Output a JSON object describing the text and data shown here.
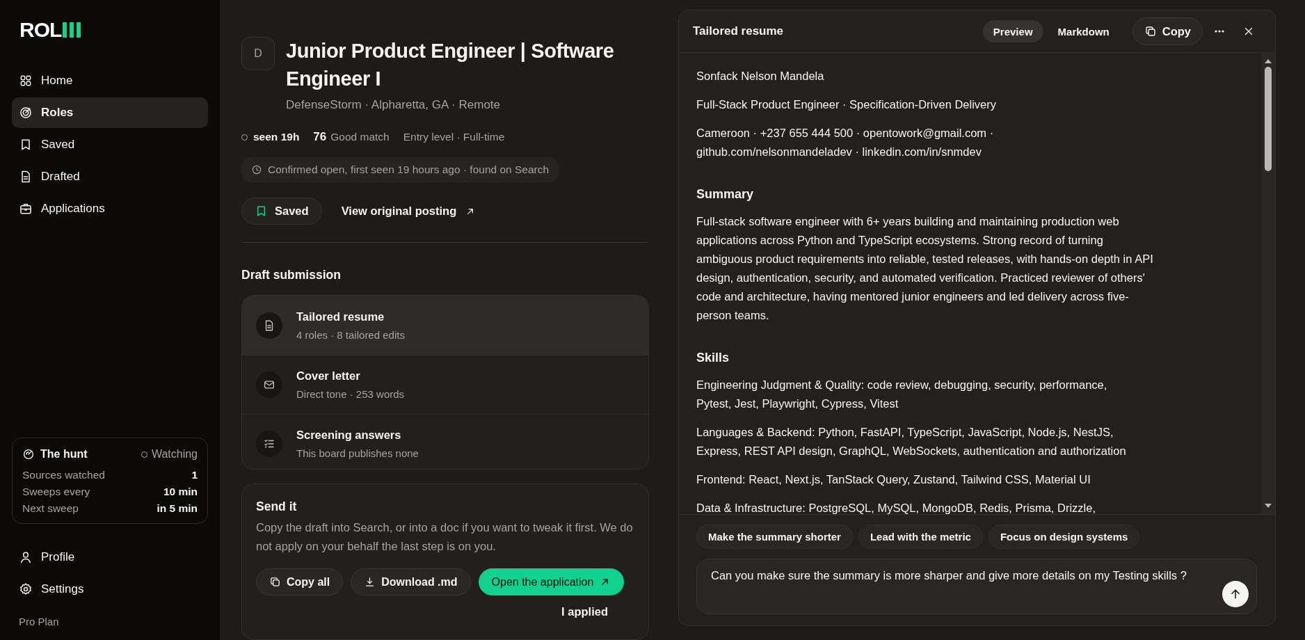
{
  "sidebar": {
    "logo": "ROL",
    "nav": [
      {
        "label": "Home",
        "selected": false
      },
      {
        "label": "Roles",
        "selected": true
      },
      {
        "label": "Saved",
        "selected": false
      },
      {
        "label": "Drafted",
        "selected": false
      },
      {
        "label": "Applications",
        "selected": false
      }
    ],
    "hunt": {
      "title": "The hunt",
      "status": "Watching",
      "stats": [
        {
          "label": "Sources watched",
          "value": "1"
        },
        {
          "label": "Sweeps every",
          "value": "10 min"
        },
        {
          "label": "Next sweep",
          "value": "in 5 min"
        }
      ]
    },
    "bottom_nav": [
      {
        "label": "Profile"
      },
      {
        "label": "Settings"
      }
    ],
    "plan": "Pro Plan"
  },
  "role": {
    "logo_letter": "D",
    "title": "Junior Product Engineer | Software Engineer I",
    "company_line": "DefenseStorm · Alpharetta, GA · Remote",
    "seen": "seen 19h",
    "score": "76",
    "match": "Good match",
    "level_type": "Entry level · Full-time",
    "confirmed": "Confirmed open, first seen 19 hours ago · found on Search",
    "saved_button": {
      "label": "Saved",
      "saved": true
    },
    "view_link": "View original posting"
  },
  "draft": {
    "heading": "Draft submission",
    "items": [
      {
        "title": "Tailored resume",
        "subtitle": "4 roles · 8 tailored edits",
        "selected": true
      },
      {
        "title": "Cover letter",
        "subtitle": "Direct tone · 253 words",
        "selected": false
      },
      {
        "title": "Screening answers",
        "subtitle": "This board publishes none",
        "selected": false
      }
    ]
  },
  "send": {
    "heading": "Send it",
    "description": "Copy the draft into Search, or into a doc if you want to tweak it first. We do not apply on your behalf the last step is on you.",
    "buttons": [
      {
        "kind": "secondary",
        "label": "Copy all"
      },
      {
        "kind": "secondary",
        "label": "Download .md"
      },
      {
        "kind": "primary",
        "label": "Open the application"
      }
    ],
    "applied_link": "I applied"
  },
  "panel": {
    "title": "Tailored resume",
    "tabs": [
      {
        "label": "Preview",
        "selected": true
      },
      {
        "label": "Markdown",
        "selected": false
      }
    ],
    "copy_button": "Copy",
    "resume": [
      {
        "kind": "line",
        "text": "Sonfack Nelson Mandela"
      },
      {
        "kind": "line",
        "text": "Full-Stack Product Engineer · Specification-Driven Delivery"
      },
      {
        "kind": "lines",
        "lines": [
          "Cameroon · +237 655 444 500 · opentowork@gmail.com ·",
          "github.com/nelsonmandeladev · linkedin.com/in/snmdev"
        ]
      },
      {
        "kind": "heading",
        "text": "Summary"
      },
      {
        "kind": "line",
        "text": "Full-stack software engineer with 6+ years building and maintaining production web applications across Python and TypeScript ecosystems. Strong record of turning ambiguous product requirements into reliable, tested releases, with hands-on depth in API design, authentication, security, and automated verification. Practiced reviewer of others' code and architecture, having mentored junior engineers and led delivery across five-person teams."
      },
      {
        "kind": "heading",
        "text": "Skills"
      },
      {
        "kind": "lines",
        "lines": [
          "Engineering Judgment & Quality: code review, debugging, security, performance,",
          "Pytest, Jest, Playwright, Cypress, Vitest"
        ]
      },
      {
        "kind": "lines",
        "lines": [
          "Languages & Backend: Python, FastAPI, TypeScript, JavaScript, Node.js, NestJS,",
          "Express, REST API design, GraphQL, WebSockets, authentication and authorization"
        ]
      },
      {
        "kind": "line",
        "text": "Frontend: React, Next.js, TanStack Query, Zustand, Tailwind CSS, Material UI"
      },
      {
        "kind": "line",
        "text": "Data & Infrastructure: PostgreSQL, MySQL, MongoDB, Redis, Prisma, Drizzle,"
      }
    ],
    "suggestions": [
      "Make the summary shorter",
      "Lead with the metric",
      "Focus on design systems"
    ],
    "prompt": {
      "value": "Can you make sure the summary is more sharper and give more details on my Testing skills ?"
    }
  }
}
